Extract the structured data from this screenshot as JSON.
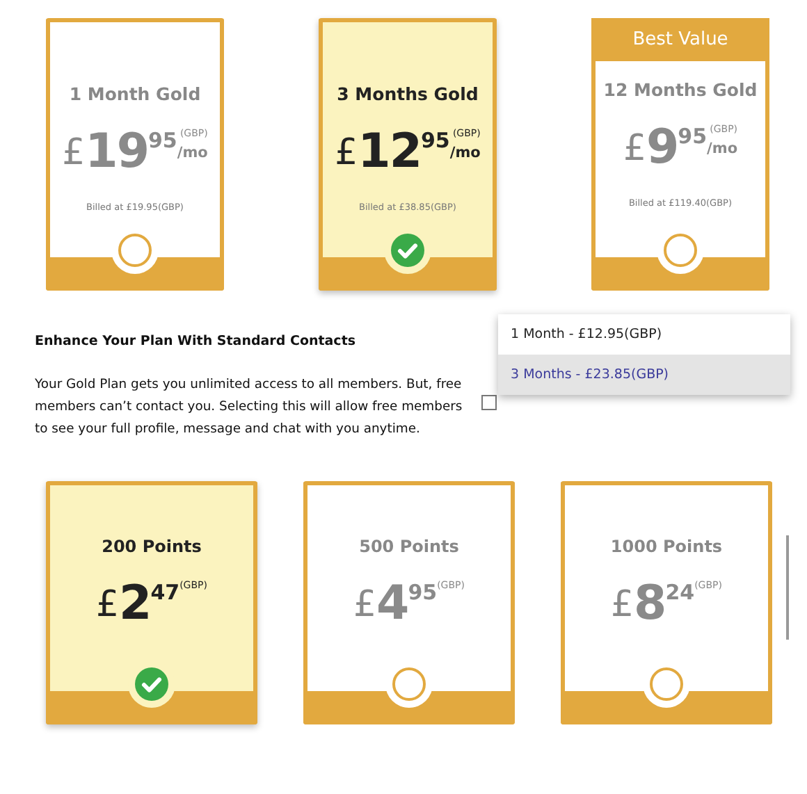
{
  "plans": [
    {
      "title": "1 Month Gold",
      "currency": "£",
      "whole": "19",
      "cents": "95",
      "code": "(GBP)",
      "unit": "/mo",
      "billed": "Billed at £19.95(GBP)",
      "selected": false
    },
    {
      "title": "3 Months Gold",
      "currency": "£",
      "whole": "12",
      "cents": "95",
      "code": "(GBP)",
      "unit": "/mo",
      "billed": "Billed at £38.85(GBP)",
      "selected": true
    },
    {
      "title": "12 Months Gold",
      "badge": "Best Value",
      "currency": "£",
      "whole": "9",
      "cents": "95",
      "code": "(GBP)",
      "unit": "/mo",
      "billed": "Billed at £119.40(GBP)",
      "selected": false
    }
  ],
  "addon": {
    "heading": "Enhance Your Plan With Standard Contacts",
    "description": "Your Gold Plan gets you unlimited access to all members. But, free members can’t contact you. Selecting this will allow free members to see your full profile, message and chat with you anytime.",
    "checked": false,
    "dropdown_options": [
      {
        "label": "1 Month - £12.95(GBP)",
        "selected": false
      },
      {
        "label": "3 Months - £23.85(GBP)",
        "selected": true
      }
    ]
  },
  "points": [
    {
      "title": "200 Points",
      "currency": "£",
      "whole": "2",
      "cents": "47",
      "code": "(GBP)",
      "selected": true
    },
    {
      "title": "500 Points",
      "currency": "£",
      "whole": "4",
      "cents": "95",
      "code": "(GBP)",
      "selected": false
    },
    {
      "title": "1000 Points",
      "currency": "£",
      "whole": "8",
      "cents": "24",
      "code": "(GBP)",
      "selected": false
    }
  ]
}
